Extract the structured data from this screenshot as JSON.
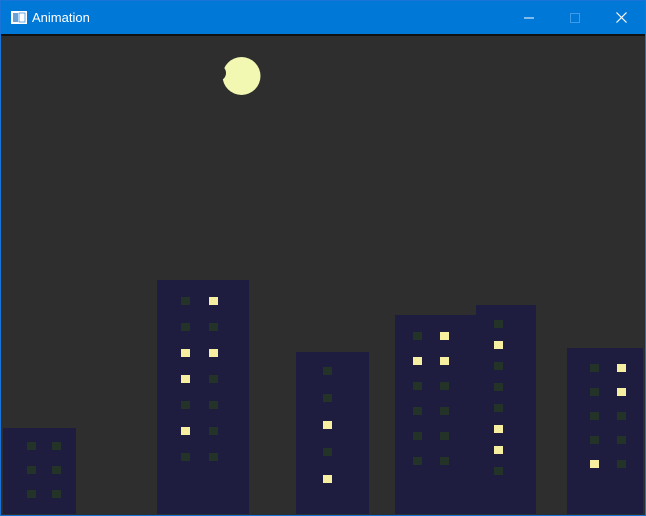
{
  "window": {
    "title": "Animation",
    "title_bar_color": "#0078d7",
    "controls": [
      "minimize",
      "maximize",
      "close"
    ]
  },
  "scene": {
    "background_color": "#2e2e2e",
    "moon_color": "#f2f7b2",
    "building_color": "#1e1d3f",
    "window_lit_color": "#f6efa0",
    "window_dark_color": "#243328"
  }
}
